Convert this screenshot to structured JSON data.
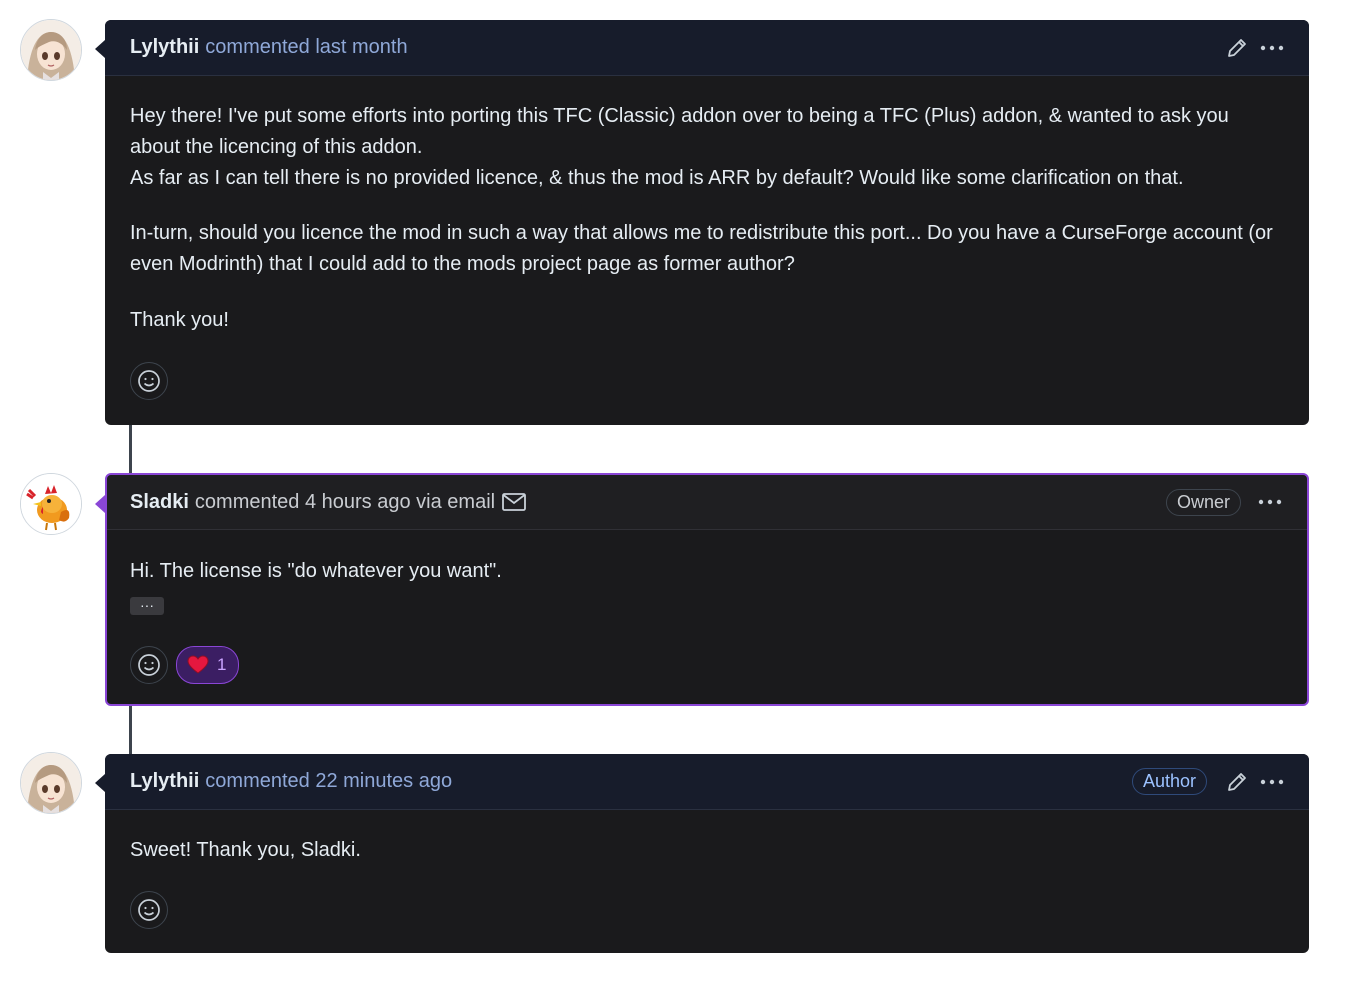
{
  "colors": {
    "highlight_border": "#8a46d6",
    "reaction_bg": "#3b1e63",
    "heart": "#e5173f"
  },
  "comments": [
    {
      "author": "Lylythii",
      "meta": "commented last month",
      "paragraphs": [
        "Hey there! I've put some efforts into porting this TFC (Classic) addon over to being a TFC (Plus) addon, & wanted to ask you about the licencing of this addon.\nAs far as I can tell there is no provided licence, & thus the mod is ARR by default? Would like some clarification on that.",
        "In-turn, should you licence the mod in such a way that allows me to redistribute this port... Do you have a CurseForge account (or even Modrinth) that I could add to the mods project page as former author?",
        "Thank you!"
      ],
      "actions": [
        "pencil-icon",
        "kebab-menu-icon"
      ]
    },
    {
      "author": "Sladki",
      "meta": "commented 4 hours ago via email",
      "badge": "Owner",
      "paragraphs": [
        "Hi. The license is \"do whatever you want\"."
      ],
      "hidden_text_button": "···",
      "reaction": {
        "emoji": "heart-icon",
        "count": "1"
      },
      "actions": [
        "kebab-menu-icon"
      ]
    },
    {
      "author": "Lylythii",
      "meta": "commented 22 minutes ago",
      "badge": "Author",
      "paragraphs": [
        "Sweet! Thank you, Sladki."
      ],
      "actions": [
        "pencil-icon",
        "kebab-menu-icon"
      ]
    }
  ]
}
